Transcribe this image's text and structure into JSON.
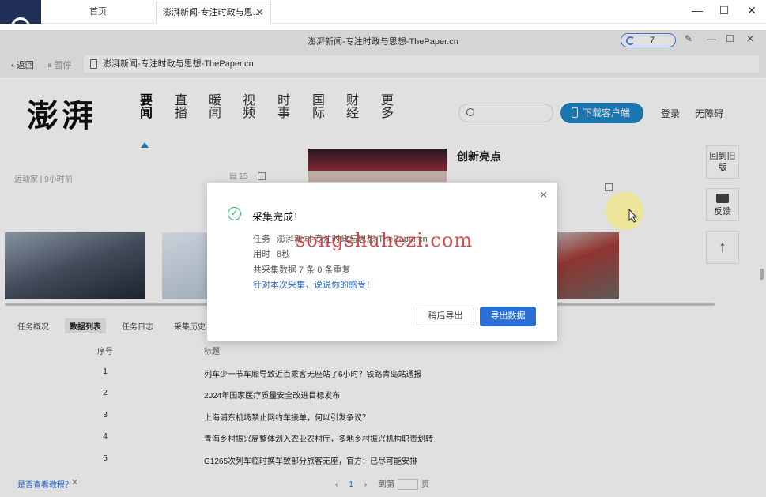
{
  "app_tabs": {
    "home": "首页",
    "active": "澎湃新闻-专注时政与思..."
  },
  "inner": {
    "title": "澎湃新闻-专注时政与思想-ThePaper.cn",
    "counter": "7",
    "back": "返回",
    "pause": "暂停",
    "url": "澎湃新闻-专注时政与思想-ThePaper.cn"
  },
  "site": {
    "logo": "澎湃",
    "menu": [
      "要闻",
      "直播",
      "暖闻",
      "视频",
      "时事",
      "国际",
      "财经",
      "更多"
    ],
    "download": "下载客户端",
    "login": "登录",
    "a11y": "无障碍",
    "meta": "运动家 | 9小时前",
    "comments": "15",
    "headline": "创新亮点",
    "side_back": "回到旧版",
    "side_feedback": "反馈"
  },
  "panel": {
    "tabs": [
      "任务概况",
      "数据列表",
      "任务日志",
      "采集历史"
    ],
    "col_no": "序号",
    "col_title": "标题",
    "rows": [
      {
        "no": "1",
        "title": "列车少一节车厢导致近百乘客无座站了6小时？铁路青岛站通报"
      },
      {
        "no": "2",
        "title": "2024年国家医疗质量安全改进目标发布"
      },
      {
        "no": "3",
        "title": "上海浦东机场禁止网约车接单，何以引发争议？"
      },
      {
        "no": "4",
        "title": "青海乡村振兴局整体划入农业农村厅，多地乡村振兴机构职责划转"
      },
      {
        "no": "5",
        "title": "G1265次列车临时换车致部分旅客无座，官方：已尽可能安排"
      }
    ],
    "help": "是否查看教程？",
    "page_current": "1",
    "goto": "到第",
    "page_unit": "页"
  },
  "dialog": {
    "title": "采集完成！",
    "task_label": "任务",
    "task_value": "澎湃新闻-专注时政与思想-ThePaper.cn",
    "time_label": "用时",
    "time_value": "8秒",
    "total_text": "共采集数据  7 条 0 条重复",
    "feedback": "针对本次采集，说说你的感受！",
    "btn_later": "稍后导出",
    "btn_export": "导出数据",
    "watermark": "songshuhezi.com"
  }
}
